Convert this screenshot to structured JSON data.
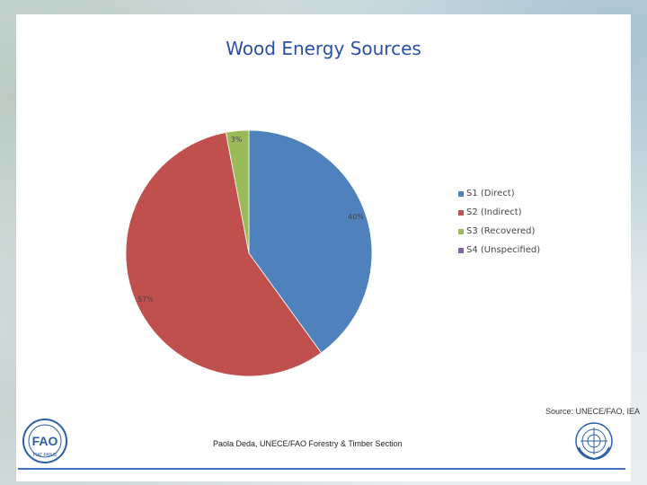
{
  "slide": {
    "source": "Source: UNECE/FAO, IEA",
    "footer": "Paola Deda, UNECE/FAO Forestry & Timber Section",
    "fao_logo_text": "FAO FIAT PANIS",
    "un_logo_text": "United Nations"
  },
  "chart_data": {
    "type": "pie",
    "title": "Wood Energy Sources",
    "slices": [
      {
        "name": "S1 (Direct)",
        "value": 40,
        "label": "40%",
        "color": "#4f81bd"
      },
      {
        "name": "S2 (Indirect)",
        "value": 57,
        "label": "57%",
        "color": "#c0504d"
      },
      {
        "name": "S3 (Recovered)",
        "value": 3,
        "label": "3%",
        "color": "#9bbb59"
      },
      {
        "name": "S4 (Unspecified)",
        "value": 0,
        "label": "",
        "color": "#8064a2"
      }
    ],
    "legend_position": "right"
  }
}
